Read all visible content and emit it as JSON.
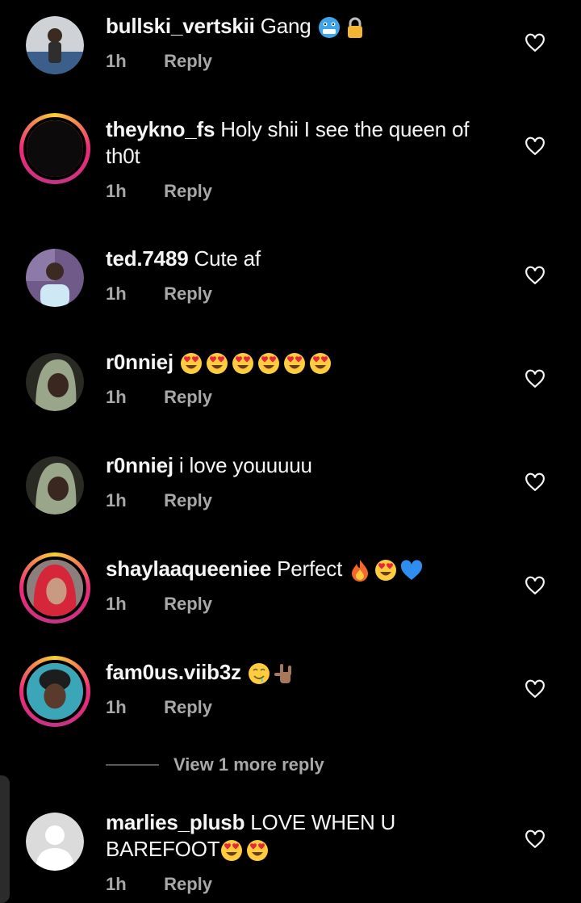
{
  "comments": [
    {
      "username": "bullski_vertskii",
      "text": "Gang",
      "time": "1h",
      "reply": "Reply",
      "emojis": [
        "cold-face-emoji",
        "lock-emoji"
      ]
    },
    {
      "username": "theykno_fs",
      "text": "Holy shii I see the queen of",
      "text2": "th0t",
      "time": "1h",
      "reply": "Reply"
    },
    {
      "username": "ted.7489",
      "text": "Cute af",
      "time": "1h",
      "reply": "Reply"
    },
    {
      "username": "r0nniej",
      "text": "",
      "time": "1h",
      "reply": "Reply",
      "emojis": [
        "heart-eyes-emoji",
        "heart-eyes-emoji",
        "heart-eyes-emoji",
        "heart-eyes-emoji",
        "heart-eyes-emoji",
        "heart-eyes-emoji"
      ]
    },
    {
      "username": "r0nniej",
      "text": "i love youuuuu",
      "time": "1h",
      "reply": "Reply"
    },
    {
      "username": "shaylaaqueeniee",
      "text": "Perfect",
      "time": "1h",
      "reply": "Reply",
      "emojis": [
        "fire-emoji",
        "heart-eyes-emoji",
        "blue-heart-emoji"
      ]
    },
    {
      "username": "fam0us.viib3z",
      "text": "",
      "time": "1h",
      "reply": "Reply",
      "emojis": [
        "drooling-face-emoji",
        "love-you-gesture-emoji"
      ]
    },
    {
      "username": "marlies_plusb",
      "text": "LOVE WHEN U",
      "text2": "BAREFOOT",
      "time": "1h",
      "reply": "Reply",
      "emojis": [
        "heart-eyes-emoji",
        "heart-eyes-emoji"
      ]
    }
  ],
  "view_more": "View 1 more reply",
  "colors": {
    "background": "#000000",
    "text": "#f5f5f5",
    "muted": "#a8a8a8",
    "story_ring_start": "#f9ce34",
    "story_ring_mid": "#ee2a7b"
  }
}
